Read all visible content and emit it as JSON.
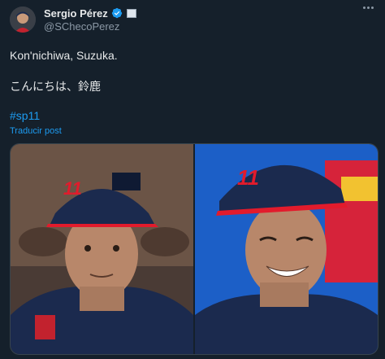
{
  "author": {
    "name": "Sergio Pérez",
    "handle": "@SChecoPerez"
  },
  "tweet": {
    "lines": [
      "Kon'nichiwa, Suzuka.",
      "こんにちは、鈴鹿"
    ],
    "hashtag": "#sp11",
    "translate_label": "Traducir post"
  },
  "media": {
    "photos": [
      {
        "cap_number": "11"
      },
      {
        "cap_number": "11"
      }
    ]
  },
  "colors": {
    "background": "#15202b",
    "link": "#1d9bf0",
    "muted": "#8b98a5",
    "verified": "#1d9bf0",
    "cap_navy": "#1b2a4e",
    "cap_red": "#e21b2c"
  }
}
